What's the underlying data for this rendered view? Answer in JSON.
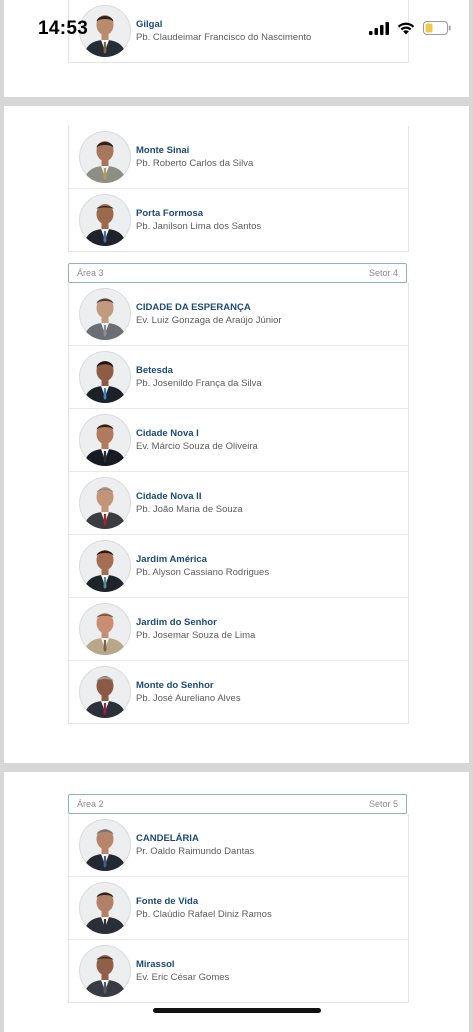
{
  "status_bar": {
    "time": "14:53",
    "icons": [
      "signal-icon",
      "wifi-icon",
      "battery-icon"
    ],
    "battery_color": "#f2c94c"
  },
  "page1": {
    "items": [
      {
        "title": "Gilgal",
        "subtitle": "Pb. Claudeimar Francisco do Nascimento"
      }
    ]
  },
  "page2": {
    "items_top": [
      {
        "title": "Monte Sinai",
        "subtitle": "Pb. Roberto Carlos da Silva"
      },
      {
        "title": "Porta Formosa",
        "subtitle": "Pb. Janilson Lima dos Santos"
      }
    ],
    "area": {
      "name": "Área 3",
      "sector": "Setor 4"
    },
    "items": [
      {
        "title": "CIDADE DA ESPERANÇA",
        "subtitle": "Ev. Luiz Gonzaga de Araújo Júnior"
      },
      {
        "title": "Betesda",
        "subtitle": "Pb. Josenildo França da Silva"
      },
      {
        "title": "Cidade Nova I",
        "subtitle": "Ev. Márcio Souza de Oliveira"
      },
      {
        "title": "Cidade Nova II",
        "subtitle": "Pb. João Maria de Souza"
      },
      {
        "title": "Jardim América",
        "subtitle": "Pb. Alyson Cassiano Rodrigues"
      },
      {
        "title": "Jardim do Senhor",
        "subtitle": "Pb. Josemar Souza de Lima"
      },
      {
        "title": "Monte do Senhor",
        "subtitle": "Pb. José Aureliano Alves"
      }
    ]
  },
  "page3": {
    "area": {
      "name": "Área 2",
      "sector": "Setor 5"
    },
    "items": [
      {
        "title": "CANDELÁRIA",
        "subtitle": "Pr. Oaldo Raimundo Dantas"
      },
      {
        "title": "Fonte de Vida",
        "subtitle": "Pb. Claúdio Rafael Diniz Ramos"
      },
      {
        "title": "Mirassol",
        "subtitle": "Ev. Eric César Gomes"
      }
    ]
  },
  "colors": {
    "title": "#1b4b7a",
    "area_border": "#8bb1ce"
  }
}
